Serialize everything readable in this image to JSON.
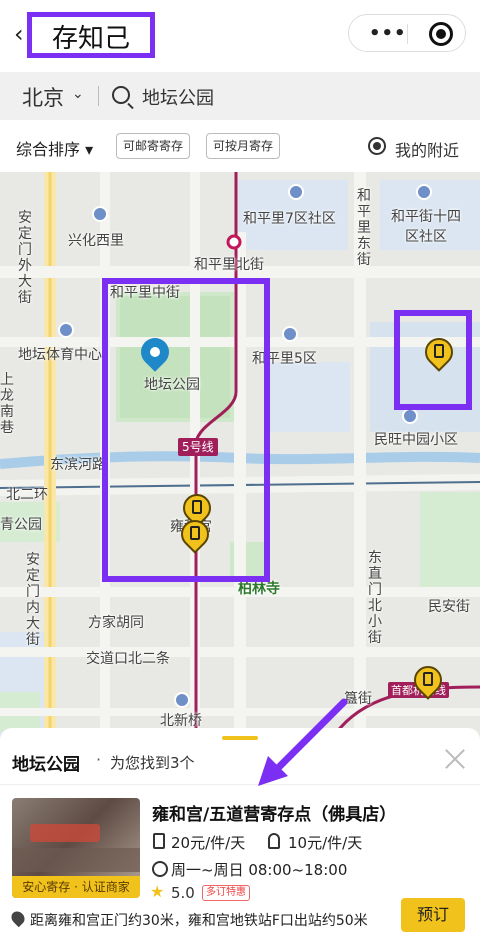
{
  "header": {
    "back_icon": "chevron-left-icon",
    "title": "存知己",
    "capsule": {
      "more_label": "•••",
      "target_icon": "target-icon"
    }
  },
  "search": {
    "city": "北京",
    "query": "地坛公园"
  },
  "filters": {
    "sort_label": "综合排序 ▾",
    "chips": [
      "可邮寄寄存",
      "可按月寄存"
    ],
    "nearby_label": "我的附近"
  },
  "map": {
    "labels": {
      "andingmen_wai": "安定门外大街",
      "xinghua_xili": "兴化西里",
      "hepingli_7": "和平里7区社区",
      "hepingli_dongjie": "和平里东街",
      "hepingjie_14": "和平街十四区社区",
      "hepingli_beijie": "和平里北街",
      "hepingli_zhongjie": "和平里中街",
      "ditan_stadium": "地坛体育中心",
      "hepingli_5": "和平里5区",
      "ditan_park": "地坛公园",
      "minwang": "民旺中园小区",
      "dongbin": "东滨河路",
      "north_2nd_ring": "北二环",
      "park_left": "青公园",
      "yonghegong": "雍和宫",
      "bailin": "柏林寺",
      "andingmen_nei": "安定门内大街",
      "dongzhimen_bei": "东直门北小街",
      "minan": "民安街",
      "fangjia": "方家胡同",
      "jiaodaokou": "交道口北二条",
      "beixinqiao": "北新桥",
      "shoudu": "首都机场线",
      "shanglong": "上龙南巷",
      "line5": "5号线",
      "gui": "簋街"
    },
    "pin_icon": "luggage-locker-icon"
  },
  "sheet": {
    "title": "地坛公园",
    "dot": "·",
    "count_text": "为您找到3个",
    "card": {
      "name": "雍和宫/五道营寄存点（佛具店）",
      "badge": "安心寄存 · 认证商家",
      "price_large": "20元/件/天",
      "price_small": "10元/件/天",
      "hours": "周一~周日 08:00~18:00",
      "rating": "5.0",
      "tag": "多订特惠"
    },
    "distance": "距离雍和宫正门约30米，雍和宫地铁站F口出站约50米",
    "book_label": "预订"
  },
  "colors": {
    "accent": "#f1c21b",
    "highlight": "#7b2ff2",
    "line5": "#a01e5a",
    "pin_blue": "#1e88c8"
  }
}
